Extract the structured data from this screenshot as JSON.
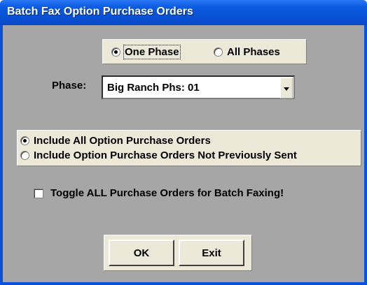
{
  "window": {
    "title": "Batch Fax Option Purchase Orders"
  },
  "phase_selector": {
    "one_phase": "One Phase",
    "all_phases": "All Phases",
    "selected": "One Phase"
  },
  "phase": {
    "label": "Phase:",
    "value": "Big Ranch Phs: 01"
  },
  "po_filter": {
    "include_all": "Include All Option Purchase Orders",
    "include_not_sent": "Include Option Purchase Orders Not Previously Sent",
    "selected": "Include All Option Purchase Orders"
  },
  "toggle_all": {
    "label": "Toggle ALL Purchase Orders for Batch Faxing!",
    "checked": false
  },
  "buttons": {
    "ok": "OK",
    "exit": "Exit"
  }
}
